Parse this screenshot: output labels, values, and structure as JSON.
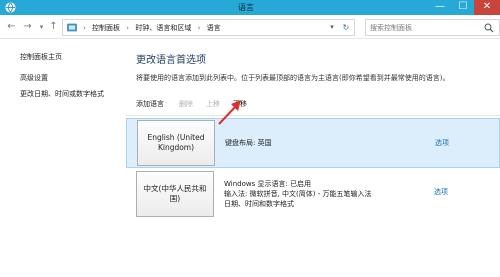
{
  "window": {
    "title": "语言",
    "minimize": "—",
    "maximize": "☐",
    "close": "✕"
  },
  "address": {
    "breadcrumbs": [
      "控制面板",
      "时钟、语言和区域",
      "语言"
    ],
    "separator": "›",
    "search_placeholder": "搜索控制面板"
  },
  "sidebar": {
    "items": [
      {
        "label": "控制面板主页"
      },
      {
        "label": "高级设置"
      },
      {
        "label": "更改日期、时间或数字格式"
      }
    ]
  },
  "main": {
    "heading": "更改语言首选项",
    "description": "将要使用的语言添加到此列表中。位于列表最顶部的语言为主语言(即你希望看到并最常使用的语言)。",
    "toolbar": {
      "add": "添加语言",
      "delete": "删除",
      "up": "上移",
      "down": "下移"
    },
    "languages": [
      {
        "name": "English (United Kingdom)",
        "details": [
          "键盘布局: 英国"
        ],
        "options": "选项"
      },
      {
        "name": "中文(中华人民共和国)",
        "details": [
          "Windows 显示语言: 已启用",
          "输入法: 微软拼音, 中文(简体) - 万能五笔输入法",
          "日期、时间和数字格式"
        ],
        "options": "选项"
      }
    ]
  },
  "colors": {
    "titlebar": "#27a9d8",
    "close": "#c7453a",
    "selected_row": "#dceefb",
    "link": "#1a6fb8",
    "arrow": "#d9312b"
  }
}
